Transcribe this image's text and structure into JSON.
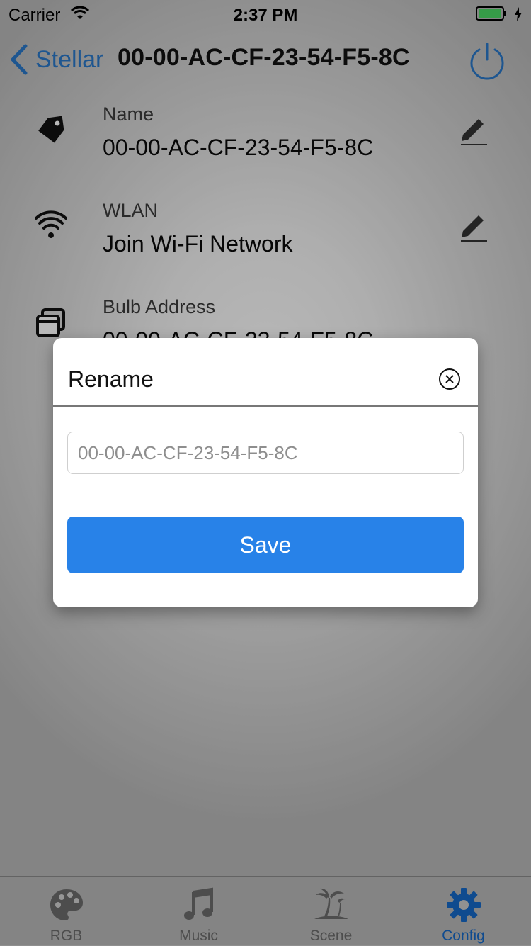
{
  "status_bar": {
    "carrier": "Carrier",
    "time": "2:37 PM",
    "wifi_icon": "wifi-icon",
    "battery_icon": "battery-charging-icon",
    "battery_color": "#4cd964"
  },
  "nav": {
    "back_label": "Stellar",
    "title": "00-00-AC-CF-23-54-F5-8C",
    "back_icon": "chevron-left-icon",
    "power_icon": "power-icon",
    "accent": "#2a78c8"
  },
  "rows": [
    {
      "label": "Name",
      "value": "00-00-AC-CF-23-54-F5-8C",
      "icon": "tag-icon",
      "editable": true
    },
    {
      "label": "WLAN",
      "value": "Join Wi-Fi Network",
      "icon": "wifi-icon",
      "editable": true
    },
    {
      "label": "Bulb Address",
      "value": "00-00-AC-CF-23-54-F5-8C",
      "icon": "windows-icon",
      "editable": false
    }
  ],
  "modal": {
    "title": "Rename",
    "close_icon": "close-circle-icon",
    "input_placeholder": "00-00-AC-CF-23-54-F5-8C",
    "input_value": "",
    "save_label": "Save",
    "save_color": "#2882e8"
  },
  "tabs": [
    {
      "label": "RGB",
      "icon": "palette-icon",
      "active": false
    },
    {
      "label": "Music",
      "icon": "music-note-icon",
      "active": false
    },
    {
      "label": "Scene",
      "icon": "palm-tree-icon",
      "active": false
    },
    {
      "label": "Config",
      "icon": "gear-icon",
      "active": true
    }
  ]
}
